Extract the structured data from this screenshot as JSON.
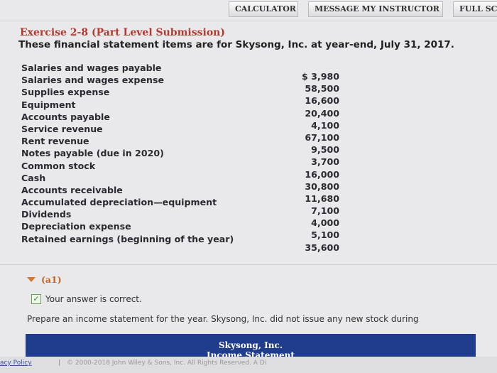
{
  "toolbar": {
    "calculator_label": "CALCULATOR",
    "message_label": "MESSAGE MY INSTRUCTOR",
    "full_label": "FULL SC"
  },
  "exercise": {
    "title": "Exercise 2-8 (Part Level Submission)",
    "subtitle": "These financial statement items are for Skysong, Inc. at year-end, July 31, 2017."
  },
  "items": [
    {
      "label": "Salaries and wages payable",
      "value": "$ 3,980"
    },
    {
      "label": "Salaries and wages expense",
      "value": "58,500"
    },
    {
      "label": "Supplies expense",
      "value": "16,600"
    },
    {
      "label": "Equipment",
      "value": "20,400"
    },
    {
      "label": "Accounts payable",
      "value": "4,100"
    },
    {
      "label": "Service revenue",
      "value": "67,100"
    },
    {
      "label": "Rent revenue",
      "value": "9,500"
    },
    {
      "label": "Notes payable (due in 2020)",
      "value": "3,700"
    },
    {
      "label": "Common stock",
      "value": "16,000"
    },
    {
      "label": "Cash",
      "value": "30,800"
    },
    {
      "label": "Accounts receivable",
      "value": "11,680"
    },
    {
      "label": "Accumulated depreciation—equipment",
      "value": "7,100"
    },
    {
      "label": "Dividends",
      "value": "4,000"
    },
    {
      "label": "Depreciation expense",
      "value": "5,100"
    },
    {
      "label": "Retained earnings (beginning of the year)",
      "value": "35,600"
    }
  ],
  "section": {
    "label": "(a1)",
    "status_text": "Your answer is correct.",
    "prompt": "Prepare an income statement for the year. Skysong, Inc. did not issue any new stock during"
  },
  "statement": {
    "company": "Skysong, Inc.",
    "name": "Income Statement"
  },
  "footer": {
    "policy_link": "acy Policy",
    "separator": "|",
    "copyright": "© 2000-2018 John Wiley & Sons, Inc. All Rights Reserved. A Di"
  },
  "colors": {
    "title": "#b13a2e",
    "statement_bar": "#1f3d8c",
    "section_accent": "#d9752c"
  }
}
